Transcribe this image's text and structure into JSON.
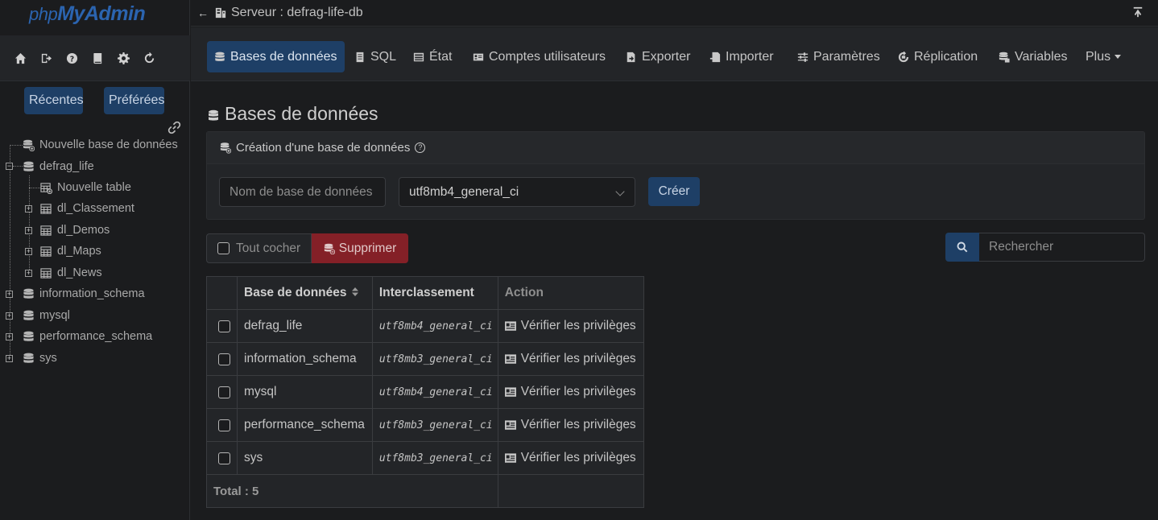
{
  "sidebar": {
    "logo_main": "php",
    "logo_brand": "MyAdmin",
    "recent_label": "Récentes",
    "favorites_label": "Préférées",
    "tree": {
      "new_db": "Nouvelle base de données",
      "defrag_life": "defrag_life",
      "new_table": "Nouvelle table",
      "tables": [
        "dl_Classement",
        "dl_Demos",
        "dl_Maps",
        "dl_News"
      ],
      "others": [
        "information_schema",
        "mysql",
        "performance_schema",
        "sys"
      ]
    }
  },
  "topbar": {
    "server_label": "Serveur : defrag-life-db"
  },
  "nav": {
    "tabs": [
      {
        "label": "Bases de données",
        "icon": "database-icon"
      },
      {
        "label": "SQL",
        "icon": "sql-icon"
      },
      {
        "label": "État",
        "icon": "status-icon"
      },
      {
        "label": "Comptes utilisateurs",
        "icon": "users-icon"
      },
      {
        "label": "Exporter",
        "icon": "export-icon"
      },
      {
        "label": "Importer",
        "icon": "import-icon"
      },
      {
        "label": "Paramètres",
        "icon": "settings-icon"
      },
      {
        "label": "Réplication",
        "icon": "replication-icon"
      },
      {
        "label": "Variables",
        "icon": "variables-icon"
      },
      {
        "label": "Plus",
        "icon": "caret-down-icon"
      }
    ]
  },
  "main": {
    "title": "Bases de données",
    "create": {
      "heading": "Création d'une base de données",
      "name_placeholder": "Nom de base de données",
      "collation_value": "utf8mb4_general_ci",
      "create_label": "Créer"
    },
    "check_all_label": "Tout cocher",
    "delete_label": "Supprimer",
    "search_placeholder": "Rechercher",
    "table": {
      "headers": [
        "Base de données",
        "Interclassement",
        "Action"
      ],
      "rows": [
        {
          "name": "defrag_life",
          "collation": "utf8mb4_general_ci",
          "action": "Vérifier les privilèges"
        },
        {
          "name": "information_schema",
          "collation": "utf8mb3_general_ci",
          "action": "Vérifier les privilèges"
        },
        {
          "name": "mysql",
          "collation": "utf8mb4_general_ci",
          "action": "Vérifier les privilèges"
        },
        {
          "name": "performance_schema",
          "collation": "utf8mb3_general_ci",
          "action": "Vérifier les privilèges"
        },
        {
          "name": "sys",
          "collation": "utf8mb3_general_ci",
          "action": "Vérifier les privilèges"
        }
      ],
      "total_label": "Total : 5"
    }
  },
  "colors": {
    "accent": "#1e3f66",
    "danger": "#842027",
    "background": "#1b1c1e"
  }
}
